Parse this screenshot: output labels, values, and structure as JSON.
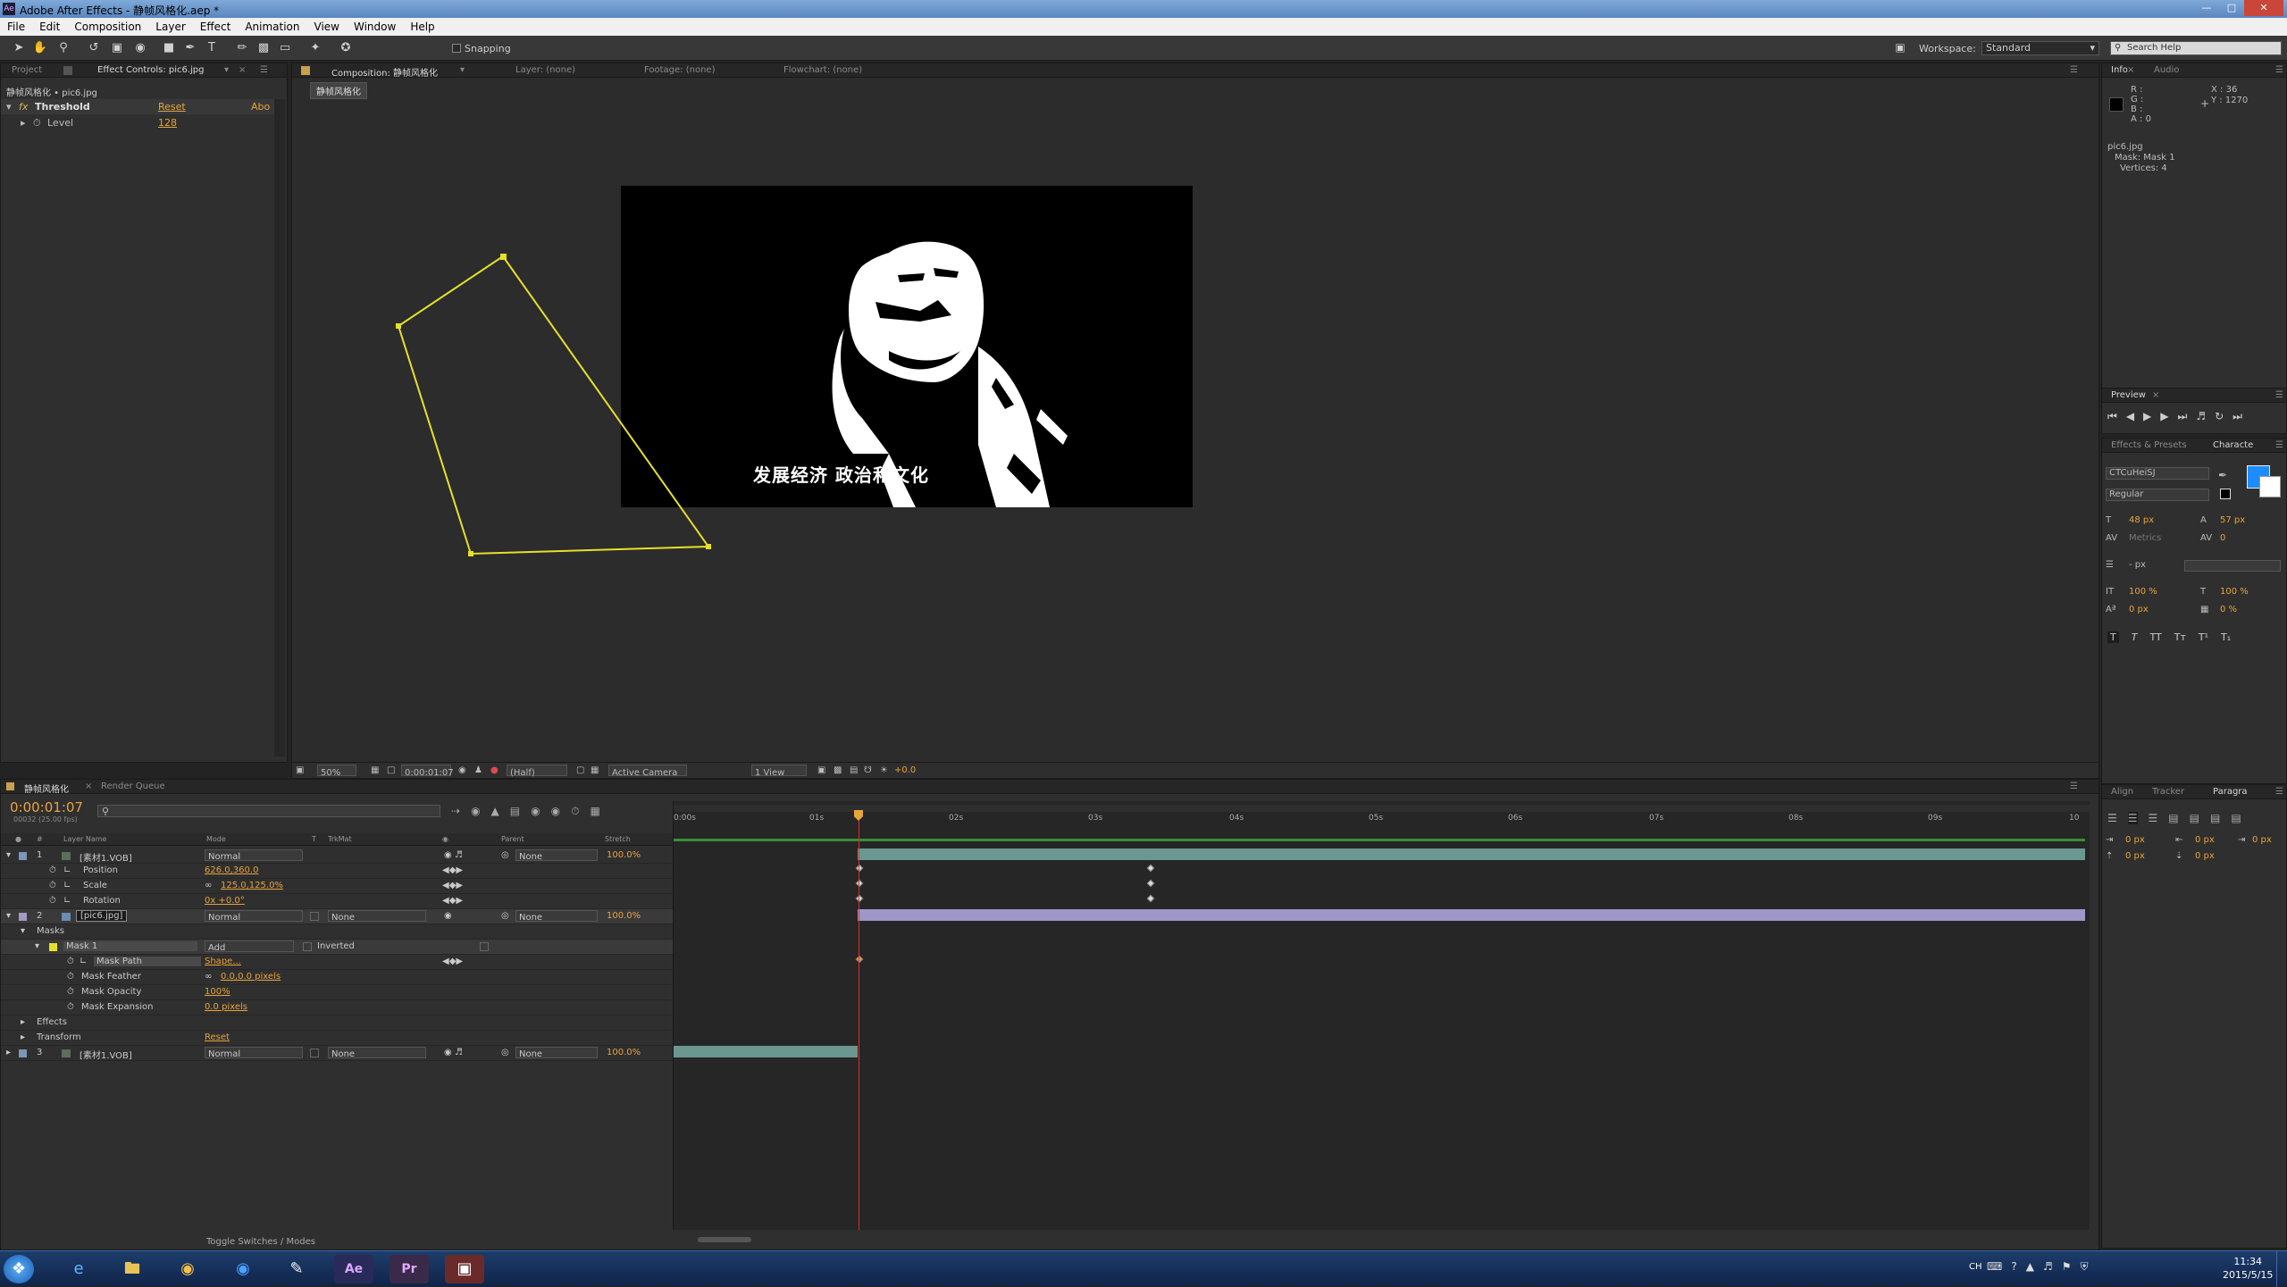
{
  "window": {
    "title": "Adobe After Effects - 静帧风格化.aep *",
    "app_badge": "Ae"
  },
  "menu": [
    "File",
    "Edit",
    "Composition",
    "Layer",
    "Effect",
    "Animation",
    "View",
    "Window",
    "Help"
  ],
  "toolbar": {
    "snapping_label": "Snapping",
    "workspace_label": "Workspace:",
    "workspace_value": "Standard",
    "search_placeholder": "Search Help"
  },
  "left_panel": {
    "tab_project": "Project",
    "tab_effect_controls": "Effect Controls: pic6.jpg",
    "crumb": "静帧风格化 • pic6.jpg",
    "effect_name": "Threshold",
    "effect_reset": "Reset",
    "effect_about": "Abo",
    "param_level_label": "Level",
    "param_level_value": "128"
  },
  "comp_panel": {
    "tab_composition": "Composition: 静帧风格化",
    "tab_layer": "Layer: (none)",
    "tab_footage": "Footage: (none)",
    "tab_flowchart": "Flowchart: (none)",
    "comp_name_tab": "静帧风格化",
    "image_caption": "发展经济 政治和文化",
    "zoom": "50%",
    "timecode": "0:00:01:07",
    "resolution": "(Half)",
    "camera": "Active Camera",
    "views": "1 View",
    "exposure": "+0.0"
  },
  "info_panel": {
    "tab_info": "Info",
    "tab_audio": "Audio",
    "r_label": "R :",
    "g_label": "G :",
    "b_label": "B :",
    "a_label": "A : 0",
    "x_value": "X : 36",
    "y_value": "Y : 1270",
    "file": "pic6.jpg",
    "mask": "Mask: Mask 1",
    "vertices": "Vertices: 4"
  },
  "preview_panel": {
    "tab": "Preview"
  },
  "character_panel": {
    "tab_effects": "Effects & Presets",
    "tab_character": "Characte",
    "font": "CTCuHeiSJ",
    "style": "Regular",
    "size": "48 px",
    "leading": "57 px",
    "kerning": "Metrics",
    "tracking": "0",
    "stroke": "- px",
    "vscale": "100 %",
    "hscale": "100 %",
    "baseline": "0 px",
    "tsume": "0 %"
  },
  "paragraph_panel": {
    "tab_align": "Align",
    "tab_tracker": "Tracker",
    "tab_paragraph": "Paragra",
    "indent1": "0 px",
    "indent2": "0 px",
    "indent3": "0 px",
    "space1": "0 px",
    "space2": "0 px"
  },
  "timeline": {
    "tab_comp": "静帧风格化",
    "tab_render": "Render Queue",
    "timecode": "0:00:01:07",
    "frames": "00032 (25.00 fps)",
    "col_layer_name": "Layer Name",
    "col_mode": "Mode",
    "col_t": "T",
    "col_trkmat": "TrkMat",
    "col_parent": "Parent",
    "col_stretch": "Stretch",
    "ruler": [
      "0:00s",
      "01s",
      "02s",
      "03s",
      "04s",
      "05s",
      "06s",
      "07s",
      "08s",
      "09s",
      "10"
    ],
    "layer1": {
      "num": "1",
      "name": "[素材1.VOB]",
      "mode": "Normal",
      "parent": "None",
      "stretch": "100.0%"
    },
    "position": {
      "label": "Position",
      "value": "626.0,360.0"
    },
    "scale": {
      "label": "Scale",
      "value": "125.0,125.0%"
    },
    "rotation": {
      "label": "Rotation",
      "value": "0x +0.0°"
    },
    "layer2": {
      "num": "2",
      "name": "[pic6.jpg]",
      "mode": "Normal",
      "trkmat": "None",
      "parent": "None",
      "stretch": "100.0%"
    },
    "masks_label": "Masks",
    "mask1": {
      "name": "Mask 1",
      "mode": "Add",
      "inverted": "Inverted"
    },
    "mask_path": {
      "label": "Mask Path",
      "value": "Shape..."
    },
    "mask_feather": {
      "label": "Mask Feather",
      "value": "0.0,0.0 pixels"
    },
    "mask_opacity": {
      "label": "Mask Opacity",
      "value": "100%"
    },
    "mask_expansion": {
      "label": "Mask Expansion",
      "value": "0.0 pixels"
    },
    "effects_label": "Effects",
    "transform_label": "Transform",
    "transform_reset": "Reset",
    "layer3": {
      "num": "3",
      "name": "[素材1.VOB]",
      "mode": "Normal",
      "trkmat": "None",
      "parent": "None",
      "stretch": "100.0%"
    },
    "toggle_label": "Toggle Switches / Modes"
  },
  "taskbar": {
    "time": "11:34",
    "date": "2015/5/15",
    "lang": "CH"
  }
}
